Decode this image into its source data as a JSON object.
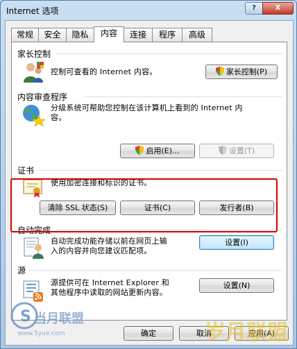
{
  "window": {
    "title": "Internet 选项",
    "help_label": "?",
    "close_label": "X"
  },
  "tabs": [
    {
      "label": "常规"
    },
    {
      "label": "安全"
    },
    {
      "label": "隐私"
    },
    {
      "label": "内容"
    },
    {
      "label": "连接"
    },
    {
      "label": "程序"
    },
    {
      "label": "高级"
    }
  ],
  "active_tab": "内容",
  "parental": {
    "title": "家长控制",
    "desc": "控制可查看的 Internet 内容。",
    "button": "家长控制(P)"
  },
  "advisor": {
    "title": "内容审查程序",
    "desc_line1": "分级系统可帮助您控制在该计算机上看到的 Internet 内",
    "desc_line2": "容。",
    "enable_button": "启用(E)...",
    "settings_button": "设置(T)"
  },
  "certificates": {
    "title": "证书",
    "desc": "使用加密连接和标识的证书。",
    "clear_ssl_button": "清除 SSL 状态(S)",
    "certificates_button": "证书(C)",
    "publishers_button": "发行者(B)"
  },
  "autocomplete": {
    "title": "自动完成",
    "desc_line1": "自动完成功能存储以前在网页上输",
    "desc_line2": "入的内容并向您建议匹配项。",
    "settings_button": "设置(I)"
  },
  "feeds": {
    "title": "源",
    "desc_line1": "源提供可在 Internet Explorer 和",
    "desc_line2": "其他程序中读取的网站更新内容。",
    "settings_button": "设置(N)"
  },
  "footer": {
    "ok": "确定",
    "cancel": "取消",
    "apply": "应用(A)"
  },
  "watermarks": {
    "left": "当月联盟",
    "left_url": "www.5yue.com",
    "right": "岁月联盟"
  },
  "colors": {
    "highlight": "#d40000",
    "title_bar": "#b8d1ec",
    "panel": "#ffffff"
  }
}
